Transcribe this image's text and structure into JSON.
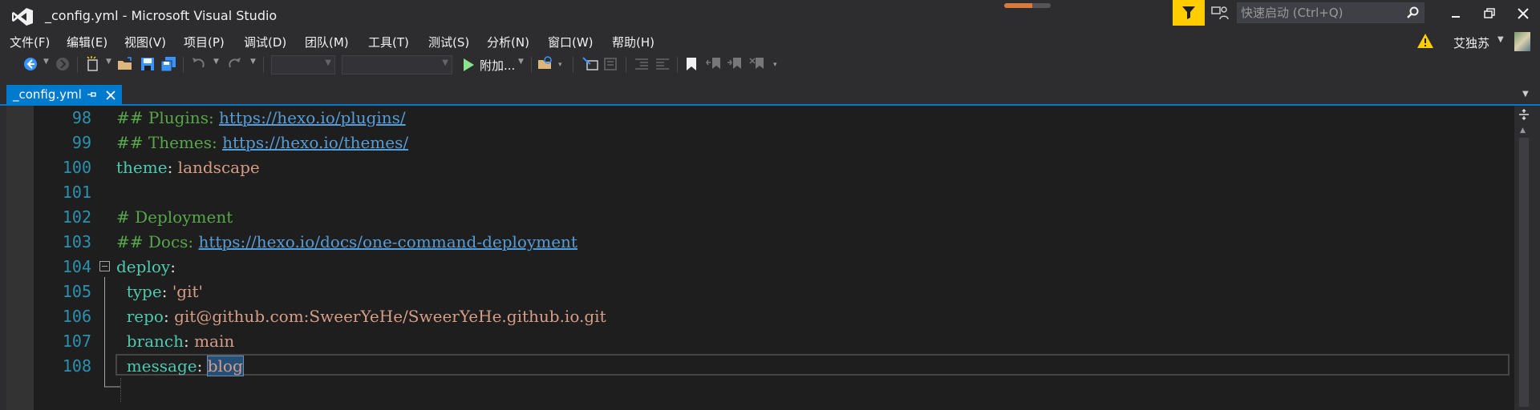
{
  "window": {
    "title": "_config.yml - Microsoft Visual Studio",
    "search_placeholder": "快速启动 (Ctrl+Q)",
    "progress": 0.6
  },
  "menu": {
    "items": [
      "文件(F)",
      "编辑(E)",
      "视图(V)",
      "项目(P)",
      "调试(D)",
      "团队(M)",
      "工具(T)",
      "测试(S)",
      "分析(N)",
      "窗口(W)",
      "帮助(H)"
    ],
    "user": "艾独苏"
  },
  "toolbar": {
    "run_label": "附加...",
    "config_combo": "",
    "platform_combo": ""
  },
  "tabs": [
    {
      "label": "_config.yml",
      "active": true
    }
  ],
  "editor": {
    "lines": [
      {
        "n": "98",
        "tokens": [
          [
            "comment",
            "## Plugins: "
          ],
          [
            "link",
            "https://hexo.io/plugins/"
          ]
        ]
      },
      {
        "n": "99",
        "tokens": [
          [
            "comment",
            "## Themes: "
          ],
          [
            "link",
            "https://hexo.io/themes/"
          ]
        ]
      },
      {
        "n": "100",
        "tokens": [
          [
            "key",
            "theme"
          ],
          [
            "punc",
            ": "
          ],
          [
            "val",
            "landscape"
          ]
        ]
      },
      {
        "n": "101",
        "tokens": []
      },
      {
        "n": "102",
        "tokens": [
          [
            "comment",
            "# Deployment"
          ]
        ]
      },
      {
        "n": "103",
        "tokens": [
          [
            "comment",
            "## Docs: "
          ],
          [
            "link",
            "https://hexo.io/docs/one-command-deployment"
          ]
        ]
      },
      {
        "n": "104",
        "tokens": [
          [
            "key",
            "deploy"
          ],
          [
            "punc",
            ":"
          ]
        ]
      },
      {
        "n": "105",
        "tokens": [
          [
            "punc",
            "  "
          ],
          [
            "key",
            "type"
          ],
          [
            "punc",
            ": "
          ],
          [
            "val",
            "'git'"
          ]
        ]
      },
      {
        "n": "106",
        "tokens": [
          [
            "punc",
            "  "
          ],
          [
            "key",
            "repo"
          ],
          [
            "punc",
            ": "
          ],
          [
            "val",
            "git@github.com:SweerYeHe/SweerYeHe.github.io.git"
          ]
        ]
      },
      {
        "n": "107",
        "tokens": [
          [
            "punc",
            "  "
          ],
          [
            "key",
            "branch"
          ],
          [
            "punc",
            ": "
          ],
          [
            "val",
            "main"
          ]
        ]
      },
      {
        "n": "108",
        "tokens": [
          [
            "punc",
            "  "
          ],
          [
            "key",
            "message"
          ],
          [
            "punc",
            ": "
          ],
          [
            "sel",
            "blog"
          ]
        ]
      }
    ],
    "current_line": "108"
  },
  "colors": {
    "accent": "#007acc",
    "line_number": "#2b91af",
    "comment": "#57a64a",
    "link": "#569cd6",
    "key": "#4ec9b0",
    "value": "#d69d85",
    "notify": "#ffcc00"
  },
  "icons": [
    "visual-studio-logo",
    "notification-flag-icon",
    "feedback-icon",
    "search-icon",
    "minimize-icon",
    "restore-icon",
    "close-icon",
    "warning-icon",
    "back-icon",
    "forward-icon",
    "new-project-icon",
    "open-file-icon",
    "save-icon",
    "save-all-icon",
    "undo-icon",
    "redo-icon",
    "start-icon",
    "find-in-files-icon",
    "pin-icon",
    "split-window-icon"
  ]
}
